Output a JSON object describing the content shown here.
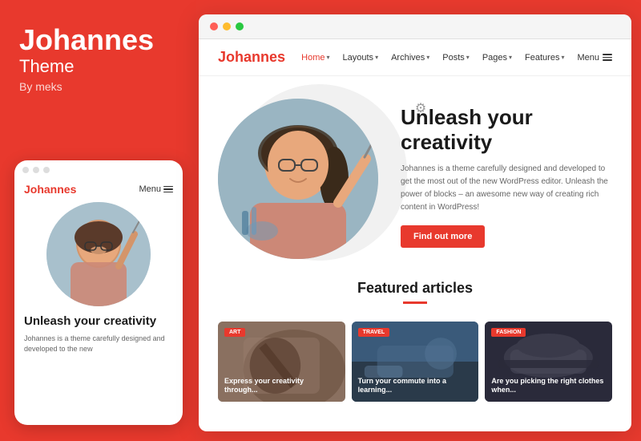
{
  "left": {
    "brand": "Johannes",
    "theme_label": "Theme",
    "by_label": "By meks"
  },
  "mobile": {
    "nav_brand": "Johannes",
    "nav_menu": "Menu",
    "hero_title": "Unleash your creativity",
    "hero_text": "Johannes is a theme carefully designed and developed to the new"
  },
  "browser": {
    "nav": {
      "brand": "Johannes",
      "links": [
        "Home",
        "Layouts",
        "Archives",
        "Posts",
        "Pages",
        "Features",
        "Menu"
      ]
    },
    "hero": {
      "title": "Unleash your creativity",
      "description": "Johannes is a theme carefully designed and developed to get the most out of the new WordPress editor. Unleash the power of blocks – an awesome new way of creating rich content in WordPress!",
      "cta_label": "Find out more"
    },
    "featured": {
      "title": "Featured articles",
      "articles": [
        {
          "badge": "Art",
          "badge_class": "badge-art",
          "card_class": "card-art",
          "title": "Express your creativity through..."
        },
        {
          "badge": "Travel",
          "badge_class": "badge-travel",
          "card_class": "card-travel",
          "title": "Turn your commute into a learning..."
        },
        {
          "badge": "Fashion",
          "badge_class": "badge-fashion",
          "card_class": "card-fashion",
          "title": "Are you picking the right clothes when..."
        }
      ]
    }
  },
  "gear_icon_label": "⚙"
}
